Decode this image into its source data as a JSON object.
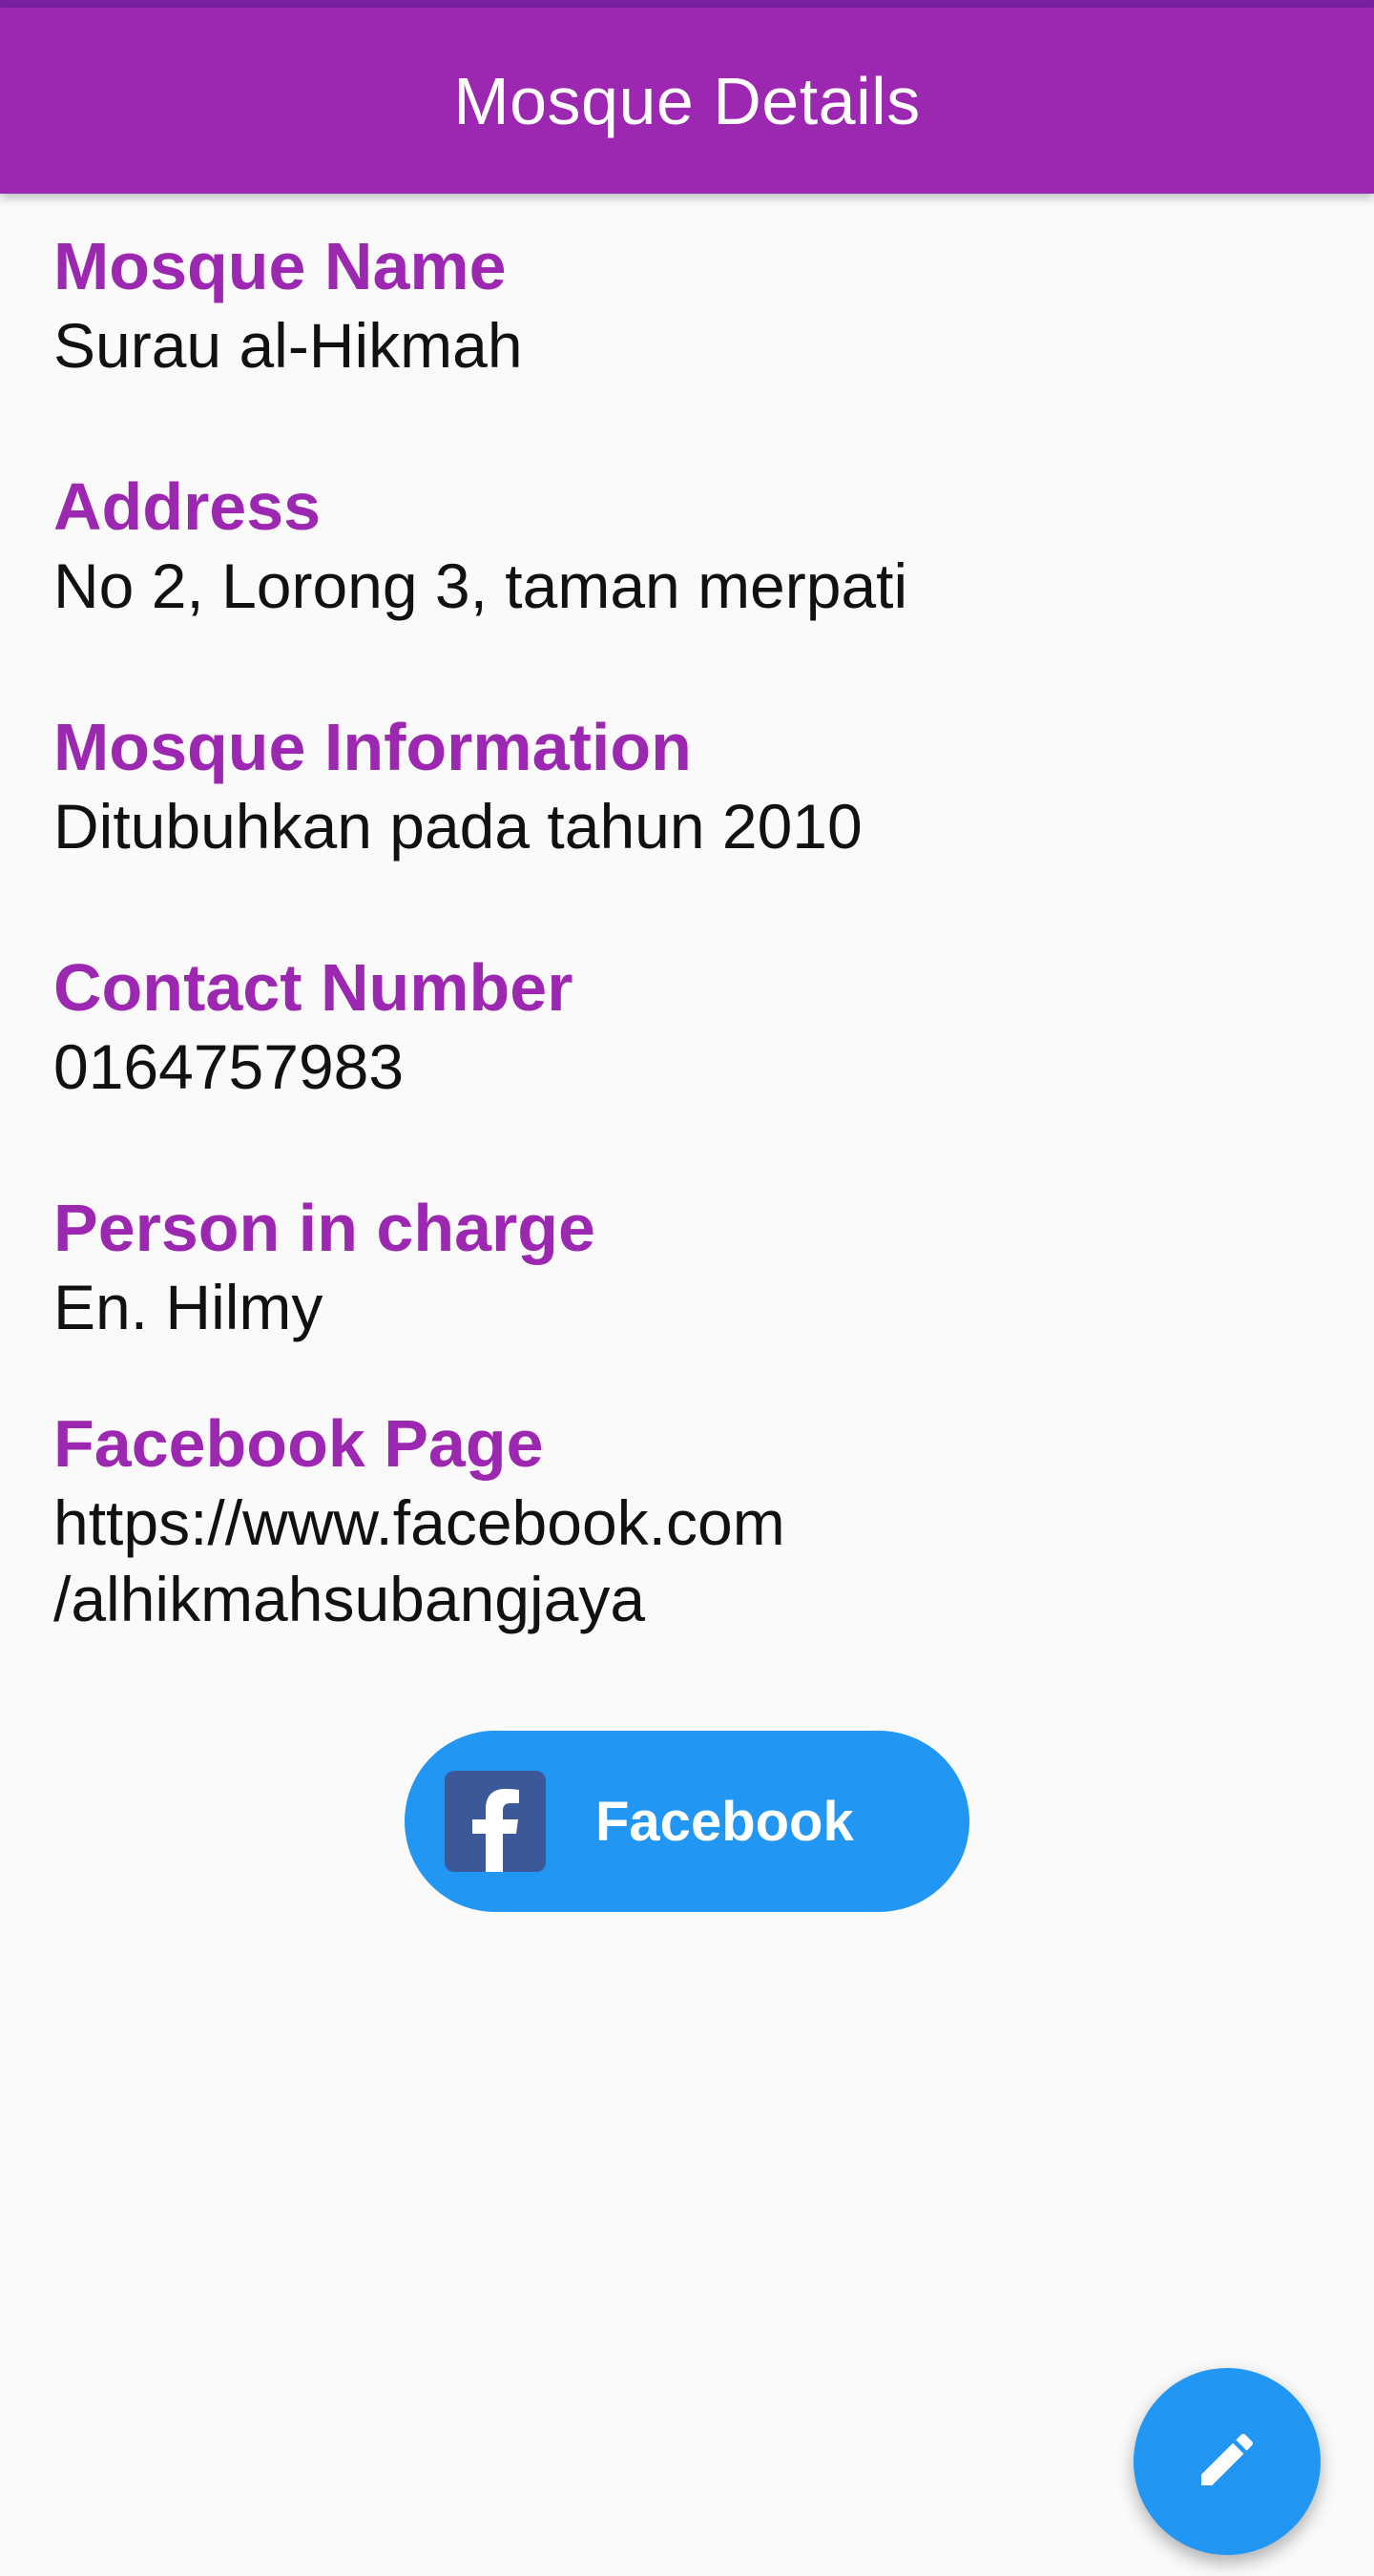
{
  "app_bar": {
    "title": "Mosque Details"
  },
  "fields": [
    {
      "label": "Mosque Name",
      "value": "Surau al-Hikmah"
    },
    {
      "label": "Address",
      "value": "No 2, Lorong 3, taman merpati"
    },
    {
      "label": "Mosque Information",
      "value": "Ditubuhkan pada tahun 2010"
    },
    {
      "label": "Contact Number",
      "value": "0164757983"
    },
    {
      "label": "Person in charge",
      "value": "En. Hilmy"
    },
    {
      "label": "Facebook Page",
      "value_line1": "https://www.facebook.com",
      "value_line2": "/alhikmahsubangjaya"
    }
  ],
  "facebook_button": {
    "label": "Facebook",
    "icon": "facebook-logo-icon"
  },
  "fab": {
    "icon": "edit-pencil-icon"
  },
  "colors": {
    "primary": "#9c27b0",
    "primary_dark": "#7b1fa2",
    "accent": "#2196f3",
    "facebook": "#3b5998",
    "background": "#fafafa"
  }
}
